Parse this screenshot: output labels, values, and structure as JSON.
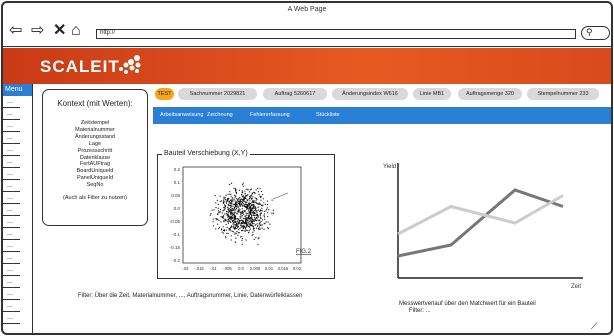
{
  "window": {
    "title": "A Web Page"
  },
  "nav": {
    "back_icon": "arrow-left-icon",
    "forward_icon": "arrow-right-icon",
    "close_icon": "x-icon",
    "home_icon": "home-icon",
    "url": "http://",
    "search_icon": "search-icon"
  },
  "brand": {
    "logo": "SCALEIT"
  },
  "sidebar": {
    "menu_label": "Menu",
    "item_marks": [
      "...",
      "...",
      "...",
      "...",
      "...",
      "...",
      "...",
      "...",
      "...",
      "...",
      "...",
      "...",
      "...",
      "...",
      "...",
      "...",
      "...",
      "...",
      "..."
    ]
  },
  "context": {
    "heading": "Kontext (mit Werten):",
    "items": [
      "Zeitstempel",
      "Materialnummer",
      "Änderungsstand",
      "Lage",
      "Prozessschritt",
      "Datenklasse",
      "FertAUFtrag",
      "BoardUniqueId",
      "PanelUniqueId",
      "SeqNo"
    ],
    "note": "(Auch als Filter zu nutzen)"
  },
  "tabs": [
    {
      "label": "TEST",
      "active": true
    },
    {
      "label": "Sachnummer 2029821",
      "active": false
    },
    {
      "label": "Auftrag 5260617",
      "active": false
    },
    {
      "label": "Änderungsindex W616",
      "active": false
    },
    {
      "label": "Linie MB1",
      "active": false
    },
    {
      "label": "Auftragsmenge 320",
      "active": false
    },
    {
      "label": "Stempelnummer 233",
      "active": false
    }
  ],
  "subnav": [
    "Arbeitsanweisung",
    "Zeichnung",
    "Fehlererfassung",
    "Stückliste"
  ],
  "scatter": {
    "title": "Bauteil Verschiebung (X,Y)",
    "fig_label": "FIG.2",
    "y_ticks": [
      "0.2",
      "0.1",
      "0.05",
      "0.0",
      "-0.05",
      "-0.1",
      "-0.15",
      "-0.2"
    ],
    "x_ticks": [
      "-.02",
      "-.015",
      "-.01",
      "-.005",
      "0.0",
      "0.005",
      "0.01",
      "0.015",
      "0.02"
    ]
  },
  "filter_text": "Filter: Über die Zeit, Materialnummer, ..., Auftragsnummer, Linie, Datenwürfelklassen",
  "chart_data": {
    "type": "line",
    "ylabel": "Yield",
    "xlabel": "Zeit",
    "series": [
      {
        "color": "#777777",
        "values": [
          0.2,
          0.3,
          0.8,
          0.65
        ]
      },
      {
        "color": "#cccccc",
        "values": [
          0.4,
          0.65,
          0.5,
          0.75
        ]
      }
    ]
  },
  "linechart": {
    "caption": "Messwertverlauf über den Matchwert für ein Bauteil",
    "filter": "Filter: ..."
  }
}
